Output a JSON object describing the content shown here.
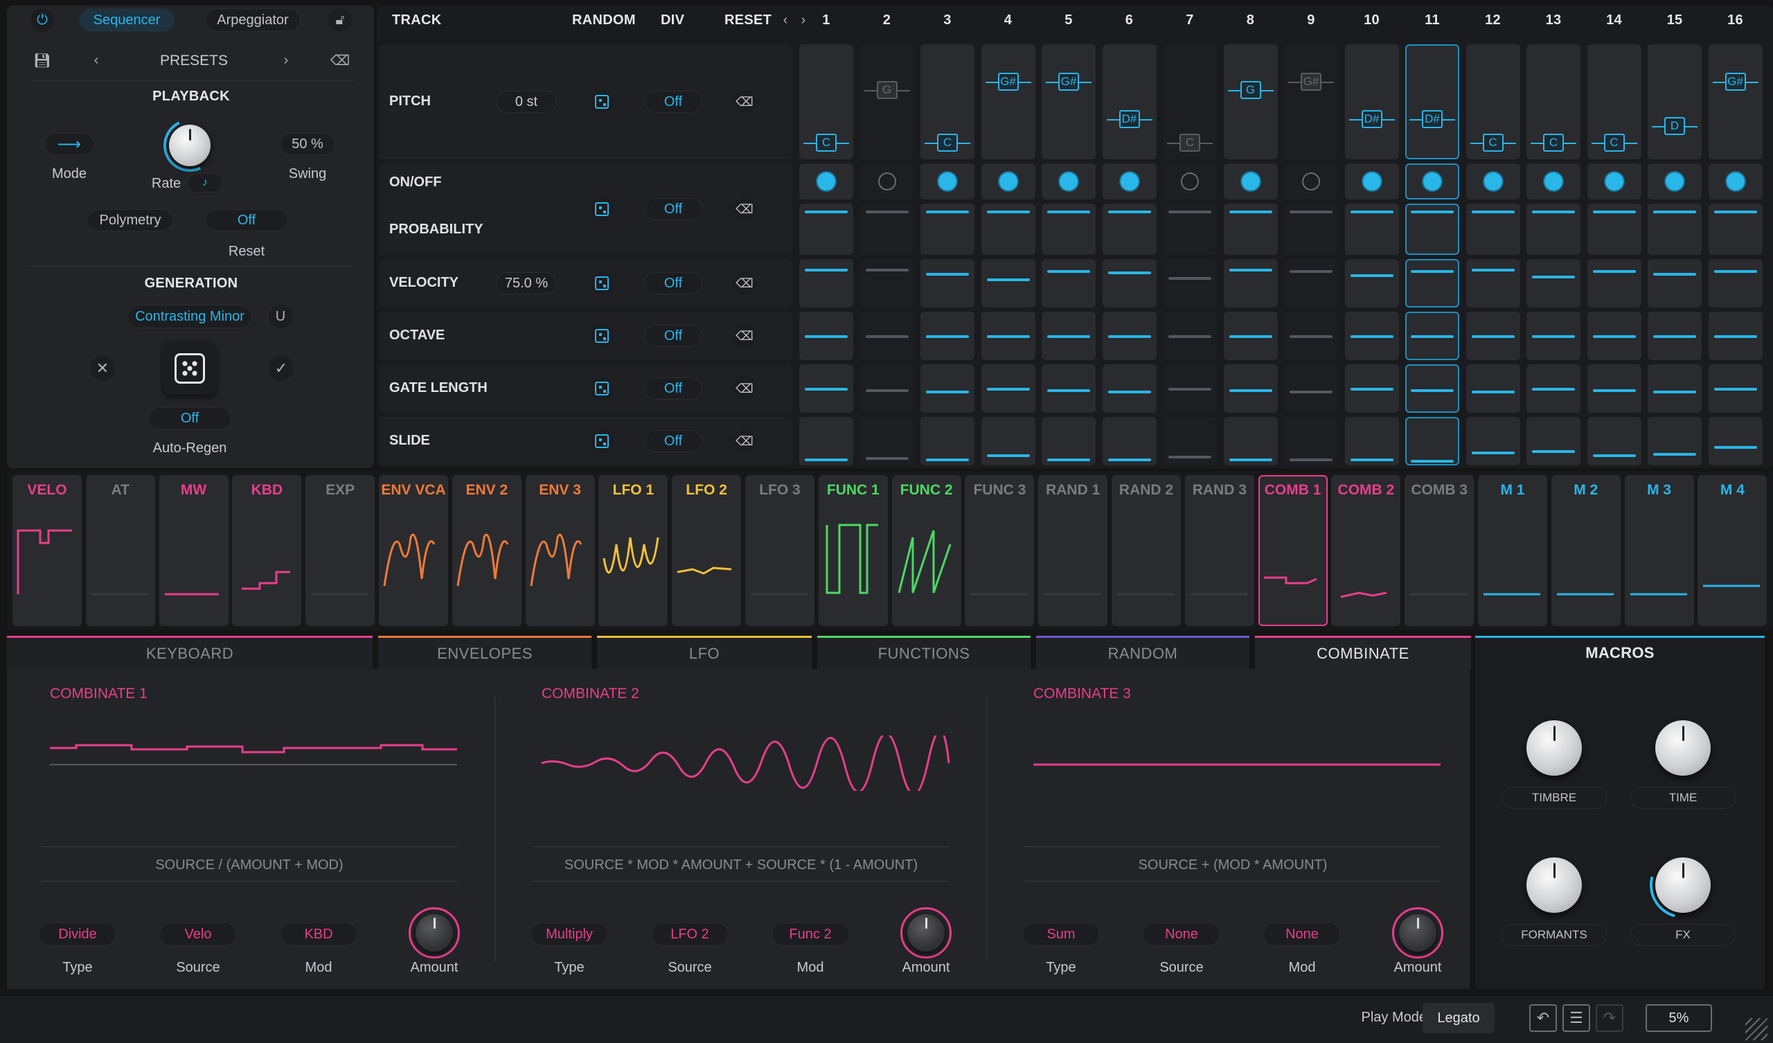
{
  "top": {
    "power_label": "⏻",
    "mode_tabs": [
      "Sequencer",
      "Arpeggiator"
    ],
    "presets_label": "PRESETS",
    "playback_title": "PLAYBACK",
    "mode_label": "Mode",
    "mode_value": "⟶",
    "rate_label": "Rate",
    "rate_note": "♪",
    "swing_value": "50 %",
    "swing_label": "Swing",
    "polymetry_label": "Polymetry",
    "reset_value": "Off",
    "reset_label": "Reset",
    "generation_title": "GENERATION",
    "generation_preset": "Contrasting Minor",
    "autoregen_value": "Off",
    "autoregen_label": "Auto-Regen"
  },
  "seq": {
    "header": {
      "track": "TRACK",
      "random": "RANDOM",
      "div": "DIV",
      "reset": "RESET"
    },
    "steps": [
      "1",
      "2",
      "3",
      "4",
      "5",
      "6",
      "7",
      "8",
      "9",
      "10",
      "11",
      "12",
      "13",
      "14",
      "15",
      "16"
    ],
    "rows": [
      {
        "name": "PITCH",
        "value": "0 st",
        "div": "Off"
      },
      {
        "name": "ON/OFF",
        "name2": "PROBABILITY",
        "value": "",
        "div": "Off"
      },
      {
        "name": "VELOCITY",
        "value": "75.0 %",
        "div": "Off"
      },
      {
        "name": "OCTAVE",
        "value": "",
        "div": "Off"
      },
      {
        "name": "GATE LENGTH",
        "value": "",
        "div": "Off"
      },
      {
        "name": "SLIDE",
        "value": "",
        "div": "Off"
      }
    ],
    "pitch_notes": [
      "C",
      "G",
      "C",
      "G#",
      "G#",
      "D#",
      "C",
      "G",
      "G#",
      "D#",
      "D#",
      "C",
      "C",
      "C",
      "D",
      "G#"
    ],
    "pitch_active": [
      true,
      false,
      true,
      true,
      true,
      true,
      false,
      true,
      false,
      true,
      true,
      true,
      true,
      true,
      true,
      true
    ]
  },
  "mod_sources": [
    "VELO",
    "AT",
    "MW",
    "KBD",
    "EXP",
    "ENV VCA",
    "ENV 2",
    "ENV 3",
    "LFO 1",
    "LFO 2",
    "LFO 3",
    "FUNC 1",
    "FUNC 2",
    "FUNC 3",
    "RAND 1",
    "RAND 2",
    "RAND 3",
    "COMB 1",
    "COMB 2",
    "COMB 3",
    "M 1",
    "M 2",
    "M 3",
    "M 4"
  ],
  "tabs": [
    "KEYBOARD",
    "ENVELOPES",
    "LFO",
    "FUNCTIONS",
    "RANDOM",
    "COMBINATE"
  ],
  "combinate": [
    {
      "title": "COMBINATE 1",
      "formula": "SOURCE / (AMOUNT + MOD)",
      "type": "Divide",
      "source": "Velo",
      "mod": "KBD"
    },
    {
      "title": "COMBINATE 2",
      "formula": "SOURCE * MOD * AMOUNT + SOURCE * (1 - AMOUNT)",
      "type": "Multiply",
      "source": "LFO 2",
      "mod": "Func 2"
    },
    {
      "title": "COMBINATE 3",
      "formula": "SOURCE + (MOD * AMOUNT)",
      "type": "Sum",
      "source": "None",
      "mod": "None"
    }
  ],
  "combinate_labels": {
    "type": "Type",
    "source": "Source",
    "mod": "Mod",
    "amount": "Amount"
  },
  "macros": {
    "title": "MACROS",
    "items": [
      "TIMBRE",
      "TIME",
      "FORMANTS",
      "FX"
    ]
  },
  "status": {
    "play_mode_label": "Play Mode",
    "play_mode_value": "Legato",
    "zoom": "5%"
  },
  "colors": {
    "accent": "#29b6e8",
    "pink": "#e83e8c",
    "orange": "#f07a3a",
    "yellow": "#f2c23a",
    "green": "#4cd964"
  }
}
